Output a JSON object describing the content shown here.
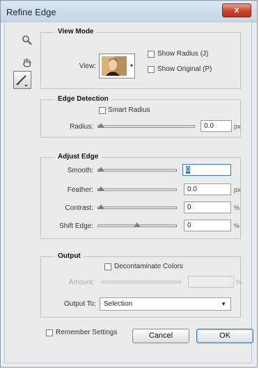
{
  "window": {
    "title": "Refine Edge",
    "close_glyph": "x"
  },
  "view_mode": {
    "legend": "View Mode",
    "view_label": "View:",
    "show_radius": {
      "label": "Show Radius (J)",
      "checked": false
    },
    "show_original": {
      "label": "Show Original (P)",
      "checked": false
    }
  },
  "edge_detection": {
    "legend": "Edge Detection",
    "smart_radius": {
      "label": "Smart Radius",
      "checked": false
    },
    "radius": {
      "label": "Radius:",
      "value": "0.0",
      "unit": "px",
      "level": 0
    }
  },
  "adjust_edge": {
    "legend": "Adjust Edge",
    "smooth": {
      "label": "Smooth:",
      "value": "0",
      "level": 0
    },
    "feather": {
      "label": "Feather:",
      "value": "0.0",
      "unit": "px",
      "level": 0
    },
    "contrast": {
      "label": "Contrast:",
      "value": "0",
      "unit": "%",
      "level": 0
    },
    "shift_edge": {
      "label": "Shift Edge:",
      "value": "0",
      "unit": "%",
      "level": 0.5
    }
  },
  "output": {
    "legend": "Output",
    "decontaminate": {
      "label": "Decontaminate Colors",
      "checked": false
    },
    "amount": {
      "label": "Amount:",
      "value": "",
      "unit": "%"
    },
    "output_to": {
      "label": "Output To:",
      "value": "Selection"
    }
  },
  "remember": {
    "label": "Remember Settings",
    "checked": false
  },
  "buttons": {
    "cancel": "Cancel",
    "ok": "OK"
  },
  "icons": {
    "zoom": "magnifier-icon",
    "hand": "hand-icon",
    "brush": "refine-radius-brush-icon",
    "dropdown": "chevron-down-icon"
  },
  "colors": {
    "accent": "#3a78c8",
    "close": "#c8452c"
  }
}
